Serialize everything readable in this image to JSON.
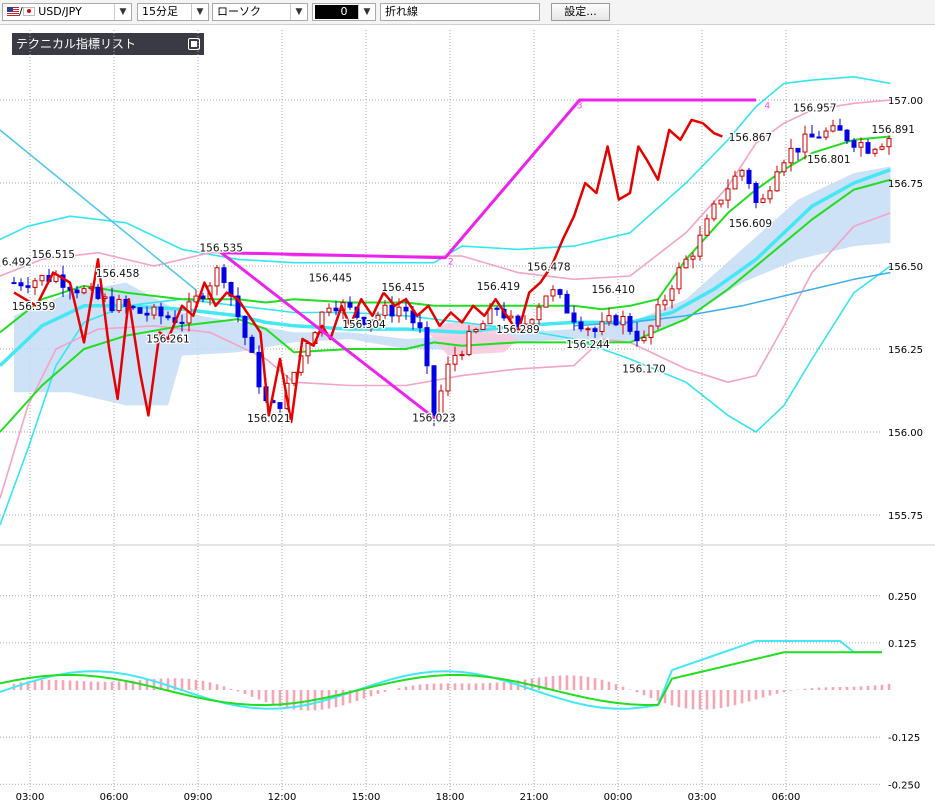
{
  "toolbar": {
    "symbol": "USD/JPY",
    "timeframe": "15分足",
    "chart_type": "ローソク",
    "color_value": "0",
    "line_style": "折れ線",
    "text_field": "",
    "settings_button": "設定..."
  },
  "indicator_list_label": "テクニカル指標リスト",
  "colors": {
    "candle_up": "#cc0000",
    "candle_down": "#0000e6",
    "bollinger_outer": "#33e6f0",
    "bollinger_inner": "#f5a3c7",
    "ma_green": "#22dd22",
    "ma_cyan": "#44e8f5",
    "trend_red": "#e60000",
    "zigzag": "#ee22ee",
    "cloud": "#c4dcf6",
    "macd_hist": "#f4a6b6"
  },
  "chart_data": [
    {
      "type": "candlestick",
      "y_ticks": [
        "157.00",
        "156.75",
        "156.50",
        "156.25",
        "156.00",
        "155.75"
      ],
      "ylim": [
        155.7,
        157.1
      ],
      "x_ticks": [
        "03:00",
        "06:00",
        "09:00",
        "12:00",
        "15:00",
        "18:00",
        "21:00",
        "00:00",
        "03:00",
        "06:00"
      ],
      "grid": true,
      "annotations": [
        {
          "label": "6.492",
          "x_hour": 0.1,
          "y": 156.492
        },
        {
          "label": "156.515",
          "x_hour": 1.4,
          "y": 156.515
        },
        {
          "label": "156.458",
          "x_hour": 3.7,
          "y": 156.458
        },
        {
          "label": "156.359",
          "x_hour": 0.7,
          "y": 156.359
        },
        {
          "label": "156.261",
          "x_hour": 5.5,
          "y": 156.261
        },
        {
          "label": "156.535",
          "x_hour": 7.4,
          "y": 156.535
        },
        {
          "label": "156.021",
          "x_hour": 9.1,
          "y": 156.021
        },
        {
          "label": "156.445",
          "x_hour": 11.3,
          "y": 156.445
        },
        {
          "label": "156.304",
          "x_hour": 12.5,
          "y": 156.304
        },
        {
          "label": "156.415",
          "x_hour": 13.9,
          "y": 156.415
        },
        {
          "label": "156.023",
          "x_hour": 15.0,
          "y": 156.023
        },
        {
          "label": "156.419",
          "x_hour": 17.3,
          "y": 156.419
        },
        {
          "label": "156.289",
          "x_hour": 18.0,
          "y": 156.289
        },
        {
          "label": "156.478",
          "x_hour": 19.1,
          "y": 156.478
        },
        {
          "label": "156.410",
          "x_hour": 21.4,
          "y": 156.41
        },
        {
          "label": "156.244",
          "x_hour": 20.5,
          "y": 156.244
        },
        {
          "label": "156.170",
          "x_hour": 22.5,
          "y": 156.17
        },
        {
          "label": "156.867",
          "x_hour": 26.3,
          "y": 156.867
        },
        {
          "label": "156.957",
          "x_hour": 28.6,
          "y": 156.957
        },
        {
          "label": "156.609",
          "x_hour": 26.3,
          "y": 156.609
        },
        {
          "label": "156.801",
          "x_hour": 29.1,
          "y": 156.801
        },
        {
          "label": "156.891",
          "x_hour": 31.4,
          "y": 156.891
        }
      ],
      "zigzag_labels": [
        "2",
        "3",
        "4"
      ],
      "last_price": "156.891"
    },
    {
      "type": "line",
      "y_ticks": [
        "0.250",
        "0.125",
        "-0.125",
        "-0.250"
      ],
      "ylim": [
        -0.25,
        0.25
      ],
      "grid": true
    }
  ]
}
